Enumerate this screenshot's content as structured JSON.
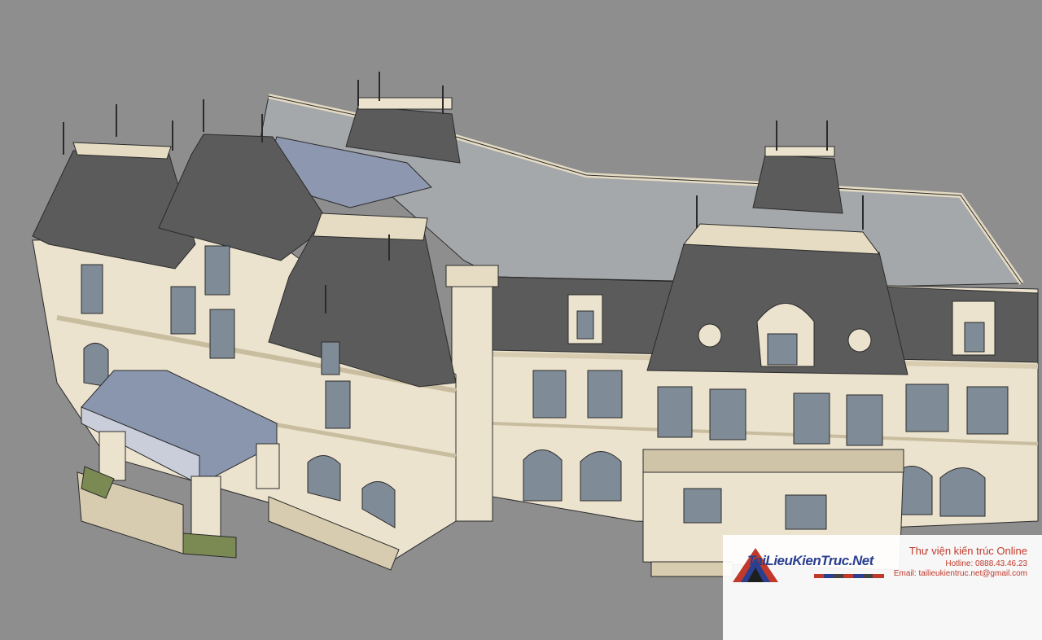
{
  "scene": {
    "subject": "french-chateau-sketchup-model",
    "colors": {
      "background": "#8e8e8e",
      "roof_slate": "#5b5b5b",
      "flat_roof": "#a5a8aa",
      "wall": "#ece3cf",
      "trim": "#dcd0b6",
      "glass": "#7f8b96",
      "canopy": "#8a96ad",
      "lawn": "#7a8a52",
      "outline": "#2b2b2b"
    }
  },
  "watermark": {
    "brand": "TaiLieuKienTruc.Net",
    "title": "Thư viện kiến trúc Online",
    "hotline": "Hotline: 0888.43.46.23",
    "email": "Email: tailieukientruc.net@gmail.com",
    "colors": {
      "brand": "#2a3f8f",
      "text": "#c0392b"
    }
  }
}
